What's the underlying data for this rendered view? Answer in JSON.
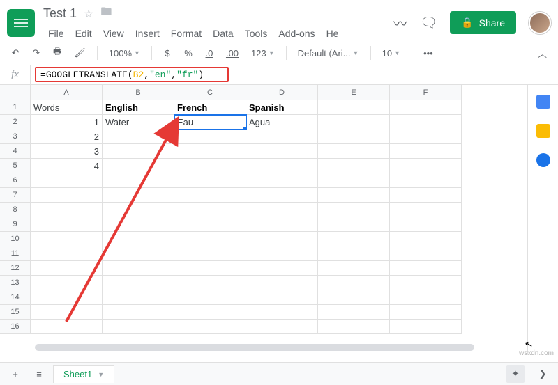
{
  "header": {
    "title": "Test 1",
    "menu": [
      "File",
      "Edit",
      "View",
      "Insert",
      "Format",
      "Data",
      "Tools",
      "Add-ons",
      "He"
    ],
    "share_label": "Share"
  },
  "toolbar": {
    "zoom": "100%",
    "currency": "$",
    "percent": "%",
    "dec_dec": ".0",
    "dec_inc": ".00",
    "fmt_more": "123",
    "font": "Default (Ari...",
    "font_size": "10",
    "more": "•••"
  },
  "formula": {
    "fx": "fx",
    "eq": "=",
    "fn": "GOOGLETRANSLATE",
    "open": "(",
    "ref": "B2",
    "sep1": ", ",
    "arg1": "\"en\"",
    "sep2": ", ",
    "arg2": "\"fr\"",
    "close": ")"
  },
  "columns": [
    "A",
    "B",
    "C",
    "D",
    "E",
    "F"
  ],
  "grid": {
    "r1": {
      "A": "Words",
      "B": "English",
      "C": "French",
      "D": "Spanish",
      "E": "",
      "F": ""
    },
    "r2": {
      "A": "1",
      "B": "Water",
      "C": "Eau",
      "D": "Agua",
      "E": "",
      "F": ""
    },
    "r3": {
      "A": "2",
      "B": "",
      "C": "",
      "D": "",
      "E": "",
      "F": ""
    },
    "r4": {
      "A": "3",
      "B": "",
      "C": "",
      "D": "",
      "E": "",
      "F": ""
    },
    "r5": {
      "A": "4",
      "B": "",
      "C": "",
      "D": "",
      "E": "",
      "F": ""
    },
    "r6": {
      "A": "",
      "B": "",
      "C": "",
      "D": "",
      "E": "",
      "F": ""
    },
    "r7": {
      "A": "",
      "B": "",
      "C": "",
      "D": "",
      "E": "",
      "F": ""
    },
    "r8": {
      "A": "",
      "B": "",
      "C": "",
      "D": "",
      "E": "",
      "F": ""
    },
    "r9": {
      "A": "",
      "B": "",
      "C": "",
      "D": "",
      "E": "",
      "F": ""
    },
    "r10": {
      "A": "",
      "B": "",
      "C": "",
      "D": "",
      "E": "",
      "F": ""
    },
    "r11": {
      "A": "",
      "B": "",
      "C": "",
      "D": "",
      "E": "",
      "F": ""
    },
    "r12": {
      "A": "",
      "B": "",
      "C": "",
      "D": "",
      "E": "",
      "F": ""
    },
    "r13": {
      "A": "",
      "B": "",
      "C": "",
      "D": "",
      "E": "",
      "F": ""
    },
    "r14": {
      "A": "",
      "B": "",
      "C": "",
      "D": "",
      "E": "",
      "F": ""
    },
    "r15": {
      "A": "",
      "B": "",
      "C": "",
      "D": "",
      "E": "",
      "F": ""
    },
    "r16": {
      "A": "",
      "B": "",
      "C": "",
      "D": "",
      "E": "",
      "F": ""
    }
  },
  "row_numbers": [
    "1",
    "2",
    "3",
    "4",
    "5",
    "6",
    "7",
    "8",
    "9",
    "10",
    "11",
    "12",
    "13",
    "14",
    "15",
    "16"
  ],
  "sheet_tab": "Sheet1",
  "watermark": "wsxdn.com"
}
